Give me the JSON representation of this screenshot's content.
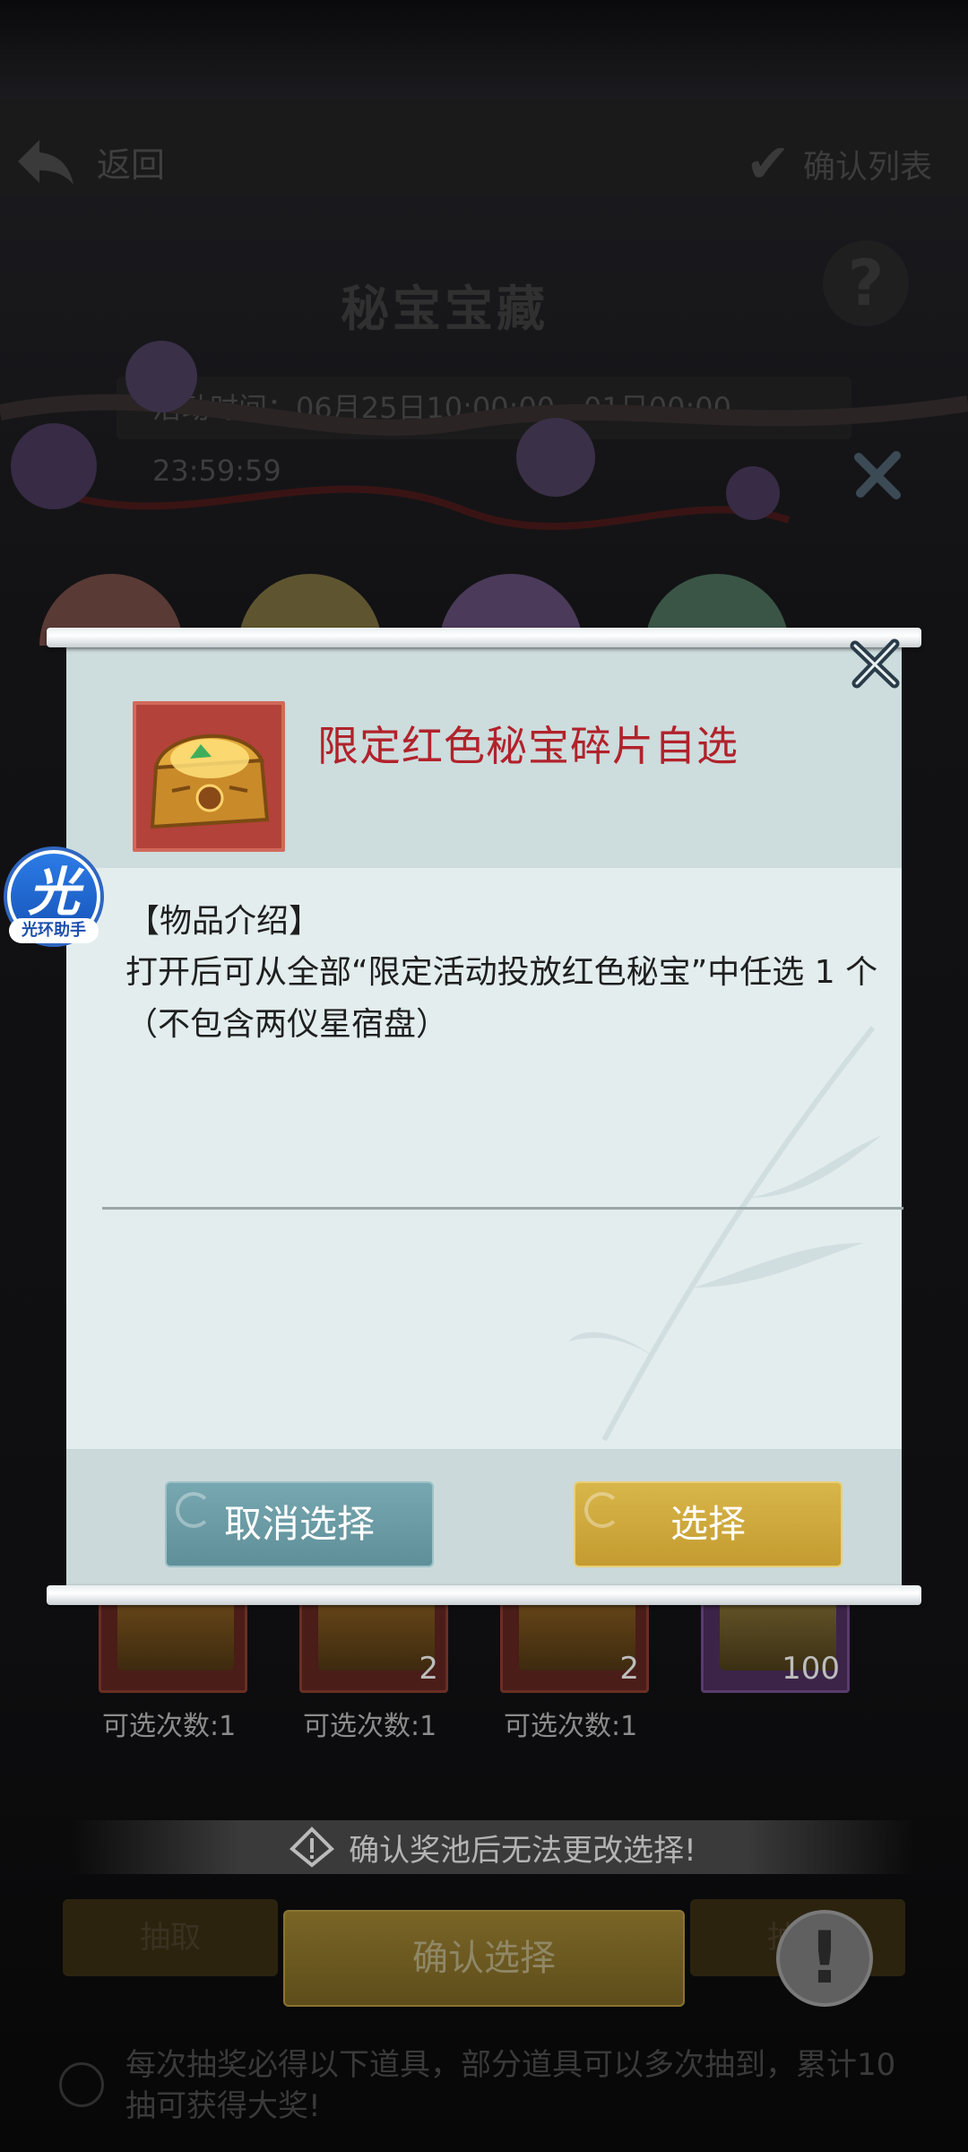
{
  "background": {
    "back_label": "返回",
    "confirm_label": "确认列表",
    "title": "秘宝宝藏",
    "time_text": "活动时间：06月25日10:00:00 - 01日00:00 23:59:59",
    "items": [
      {
        "count": "",
        "choices": "可选次数:1"
      },
      {
        "count": "2",
        "choices": "可选次数:1"
      },
      {
        "count": "2",
        "choices": "可选次数:1"
      },
      {
        "count": "100",
        "choices": ""
      }
    ],
    "warning": "确认奖池后无法更改选择!",
    "left_button": "抽取",
    "right_button": "抽取",
    "confirm_selection": "确认选择",
    "footer_note": "每次抽奖必得以下道具，部分道具可以多次抽到，累计10抽可获得大奖!"
  },
  "dialog": {
    "item_name": "限定红色秘宝碎片自选",
    "desc_heading": "【物品介绍】",
    "desc_text": "打开后可从全部“限定活动投放红色秘宝”中任选 1 个（不包含两仪星宿盘）",
    "cancel_label": "取消选择",
    "select_label": "选择"
  },
  "assistant": {
    "glyph": "光",
    "label": "光环助手"
  },
  "colors": {
    "title_red": "#b1222b",
    "cancel_teal": "#6b9ba5",
    "select_gold": "#cfa93d",
    "paper": "#dde8e9"
  }
}
